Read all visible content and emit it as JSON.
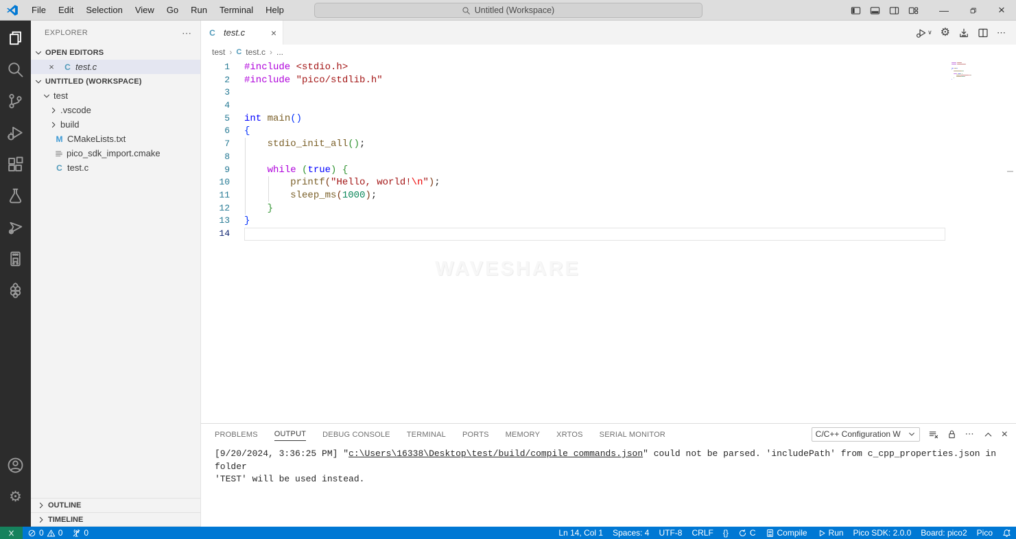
{
  "title_bar": {
    "menus": [
      "File",
      "Edit",
      "Selection",
      "View",
      "Go",
      "Run",
      "Terminal",
      "Help"
    ],
    "search_label": "Untitled (Workspace)"
  },
  "activity_bar": {
    "top": [
      {
        "name": "explorer",
        "active": true
      },
      {
        "name": "search",
        "active": false
      },
      {
        "name": "source-control",
        "active": false
      },
      {
        "name": "run-debug",
        "active": false
      },
      {
        "name": "extensions",
        "active": false
      },
      {
        "name": "testing",
        "active": false
      },
      {
        "name": "cmake",
        "active": false
      },
      {
        "name": "pico-board",
        "active": false
      },
      {
        "name": "raspberry-pi",
        "active": false
      }
    ],
    "bottom": [
      {
        "name": "account",
        "active": false
      },
      {
        "name": "settings",
        "active": false
      }
    ]
  },
  "sidebar": {
    "title": "EXPLORER",
    "more_label": "⋯",
    "rows": [
      {
        "kind": "section",
        "label": "OPEN EDITORS",
        "chevron": "down"
      },
      {
        "kind": "open-file",
        "label": "test.c",
        "icon": "c",
        "selected": true,
        "italic": true
      },
      {
        "kind": "section",
        "label": "UNTITLED (WORKSPACE)",
        "chevron": "down"
      },
      {
        "kind": "folder",
        "label": "test",
        "chevron": "down",
        "indent": 0
      },
      {
        "kind": "folder",
        "label": ".vscode",
        "chevron": "right",
        "indent": 1
      },
      {
        "kind": "folder",
        "label": "build",
        "chevron": "right",
        "indent": 1
      },
      {
        "kind": "file",
        "label": "CMakeLists.txt",
        "icon": "m",
        "indent": 1
      },
      {
        "kind": "file",
        "label": "pico_sdk_import.cmake",
        "icon": "list",
        "indent": 1
      },
      {
        "kind": "file",
        "label": "test.c",
        "icon": "c",
        "indent": 1
      }
    ],
    "footer": [
      "OUTLINE",
      "TIMELINE"
    ]
  },
  "editor": {
    "tab": {
      "label": "test.c",
      "icon": "c"
    },
    "breadcrumb": {
      "folder": "test",
      "file": "test.c",
      "tail": "..."
    },
    "watermark": "WAVESHARE",
    "cursor_line": 14,
    "code_lines": [
      [
        [
          "kw",
          "#include"
        ],
        [
          "pl",
          " "
        ],
        [
          "str",
          "<stdio.h>"
        ]
      ],
      [
        [
          "kw",
          "#include"
        ],
        [
          "pl",
          " "
        ],
        [
          "str",
          "\"pico/stdlib.h\""
        ]
      ],
      [],
      [],
      [
        [
          "type",
          "int"
        ],
        [
          "pl",
          " "
        ],
        [
          "fn",
          "main"
        ],
        [
          "b1",
          "()"
        ]
      ],
      [
        [
          "b1",
          "{"
        ]
      ],
      [
        [
          "pl",
          "    "
        ],
        [
          "fn",
          "stdio_init_all"
        ],
        [
          "b2",
          "()"
        ],
        [
          "pl",
          ";"
        ]
      ],
      [],
      [
        [
          "pl",
          "    "
        ],
        [
          "kw",
          "while"
        ],
        [
          "pl",
          " "
        ],
        [
          "b2",
          "("
        ],
        [
          "type",
          "true"
        ],
        [
          "b2",
          ")"
        ],
        [
          "pl",
          " "
        ],
        [
          "b2",
          "{"
        ]
      ],
      [
        [
          "pl",
          "        "
        ],
        [
          "fn",
          "printf"
        ],
        [
          "b3",
          "("
        ],
        [
          "str",
          "\"Hello, world!"
        ],
        [
          "esc",
          "\\n"
        ],
        [
          "str",
          "\""
        ],
        [
          "b3",
          ")"
        ],
        [
          "pl",
          ";"
        ]
      ],
      [
        [
          "pl",
          "        "
        ],
        [
          "fn",
          "sleep_ms"
        ],
        [
          "b3",
          "("
        ],
        [
          "num",
          "1000"
        ],
        [
          "b3",
          ")"
        ],
        [
          "pl",
          ";"
        ]
      ],
      [
        [
          "pl",
          "    "
        ],
        [
          "b2",
          "}"
        ]
      ],
      [
        [
          "b1",
          "}"
        ]
      ],
      []
    ]
  },
  "panel": {
    "tabs": [
      {
        "label": "PROBLEMS",
        "active": false
      },
      {
        "label": "OUTPUT",
        "active": true
      },
      {
        "label": "DEBUG CONSOLE",
        "active": false
      },
      {
        "label": "TERMINAL",
        "active": false
      },
      {
        "label": "PORTS",
        "active": false
      },
      {
        "label": "MEMORY",
        "active": false
      },
      {
        "label": "XRTOS",
        "active": false
      },
      {
        "label": "SERIAL MONITOR",
        "active": false
      }
    ],
    "dropdown_label": "C/C++ Configuration W",
    "output_lines": [
      {
        "segments": [
          {
            "text": "[9/20/2024, 3:36:25 PM] \"",
            "link": false
          },
          {
            "text": "c:\\Users\\16338\\Desktop\\test/build/compile_commands.json",
            "link": true
          },
          {
            "text": "\" could not be parsed. 'includePath' from c_cpp_properties.json in folder",
            "link": false
          }
        ]
      },
      {
        "segments": [
          {
            "text": "'TEST' will be used instead.",
            "link": false
          }
        ]
      }
    ]
  },
  "status_bar": {
    "left": [
      {
        "name": "remote"
      },
      {
        "name": "problems",
        "errors": "0",
        "warnings": "0"
      },
      {
        "name": "ports",
        "count": "0"
      }
    ],
    "right": [
      {
        "name": "cursor-position",
        "text": "Ln 14, Col 1"
      },
      {
        "name": "indentation",
        "text": "Spaces: 4"
      },
      {
        "name": "encoding",
        "text": "UTF-8"
      },
      {
        "name": "eol",
        "text": "CRLF"
      },
      {
        "name": "intellisense-braces",
        "text": "{}"
      },
      {
        "name": "language-mode",
        "icon": "sync",
        "text": "C"
      },
      {
        "name": "compile",
        "icon": "chip",
        "text": "Compile"
      },
      {
        "name": "run",
        "icon": "play",
        "text": "Run"
      },
      {
        "name": "pico-sdk",
        "text": "Pico SDK: 2.0.0"
      },
      {
        "name": "board",
        "text": "Board: pico2"
      },
      {
        "name": "pico",
        "text": "Pico"
      },
      {
        "name": "notifications",
        "icon": "bell",
        "text": ""
      }
    ]
  },
  "colors": {
    "status_bar": "#0078d4",
    "remote_indicator": "#16825d",
    "activity_bar": "#2c2c2c",
    "list_selection": "#e4e6f1",
    "c_file_icon": "#519aba",
    "keyword": "#AF00DB",
    "type_keyword": "#0000FF",
    "string": "#A31515",
    "function": "#795E26",
    "number": "#098658"
  }
}
